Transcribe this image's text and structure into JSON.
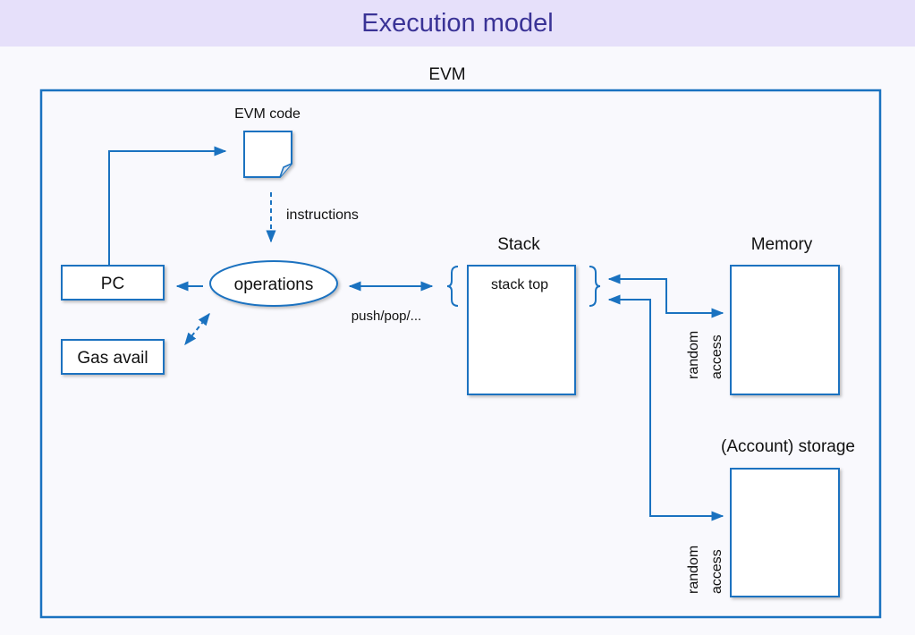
{
  "slide": {
    "title": "Execution model"
  },
  "diagram": {
    "container_label": "EVM",
    "code_label": "EVM code",
    "instructions_label": "instructions",
    "pc_label": "PC",
    "gas_label": "Gas avail",
    "operations_label": "operations",
    "push_pop_label": "push/pop/...",
    "stack_label": "Stack",
    "stack_top_label": "stack top",
    "memory_label": "Memory",
    "memory_access_line1": "random",
    "memory_access_line2": "access",
    "storage_label": "(Account) storage",
    "storage_access_line1": "random",
    "storage_access_line2": "access"
  },
  "colors": {
    "accent": "#1a72c0",
    "title_bar": "#e6e0fa",
    "title_text": "#3a3396"
  }
}
